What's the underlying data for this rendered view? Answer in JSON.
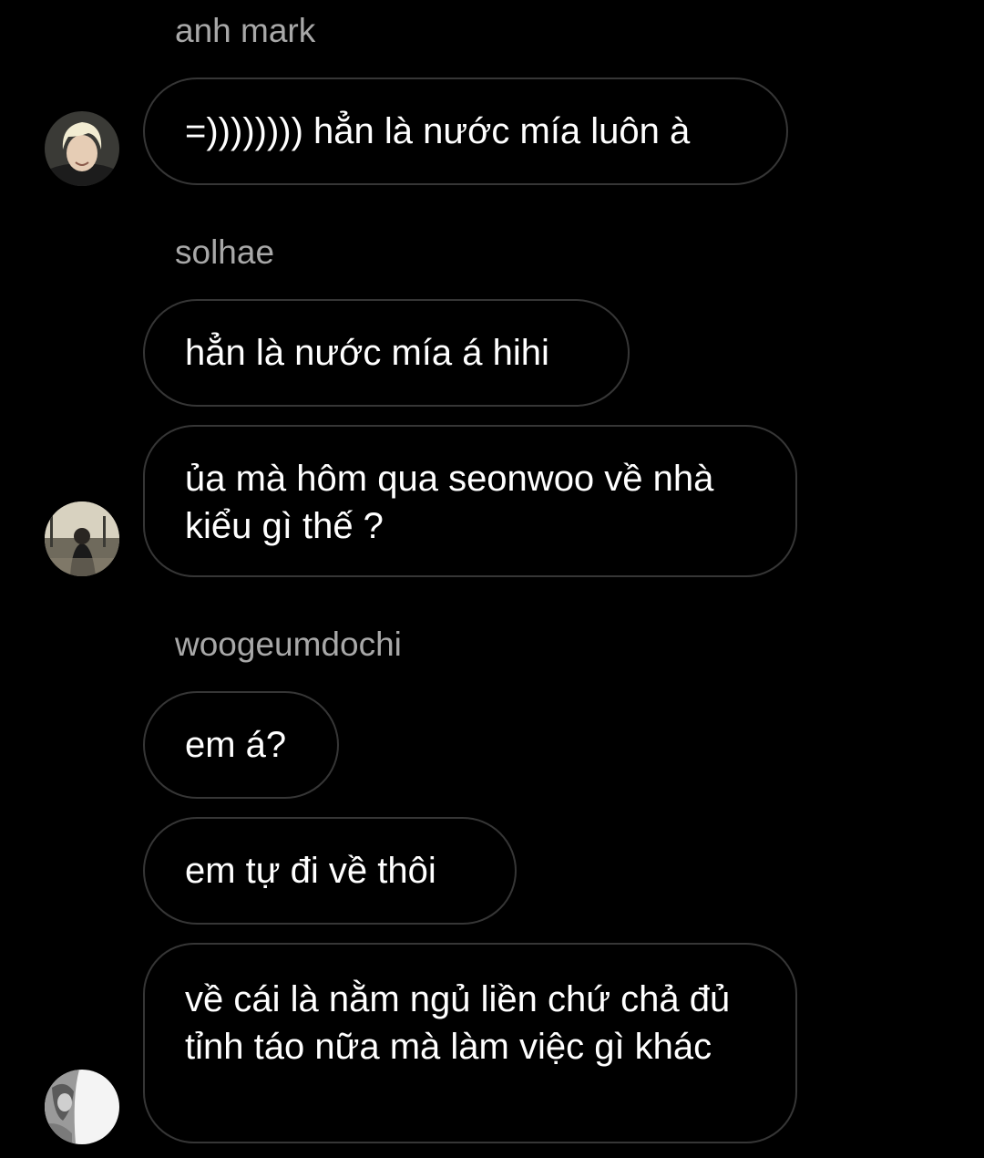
{
  "thread": {
    "groups": [
      {
        "sender": "anh mark",
        "avatar_icon": "user-avatar-blond",
        "messages": [
          "=)))))))) hẳn là nước mía luôn à"
        ]
      },
      {
        "sender": "solhae",
        "avatar_icon": "user-avatar-street-photo",
        "messages": [
          "hẳn là nước mía á hihi",
          "ủa mà hôm qua seonwoo về nhà kiểu gì thế ?"
        ]
      },
      {
        "sender": "woogeumdochi",
        "avatar_icon": "user-avatar-bw-photo",
        "messages": [
          "em á?",
          "em tự đi về thôi",
          "về cái là nằm ngủ liền chứ chả đủ tỉnh táo nữa mà làm việc gì khác"
        ]
      }
    ]
  },
  "colors": {
    "background": "#000000",
    "bubble_border": "#363636",
    "message_text": "#ffffff",
    "sender_name": "#a8a8a8"
  }
}
